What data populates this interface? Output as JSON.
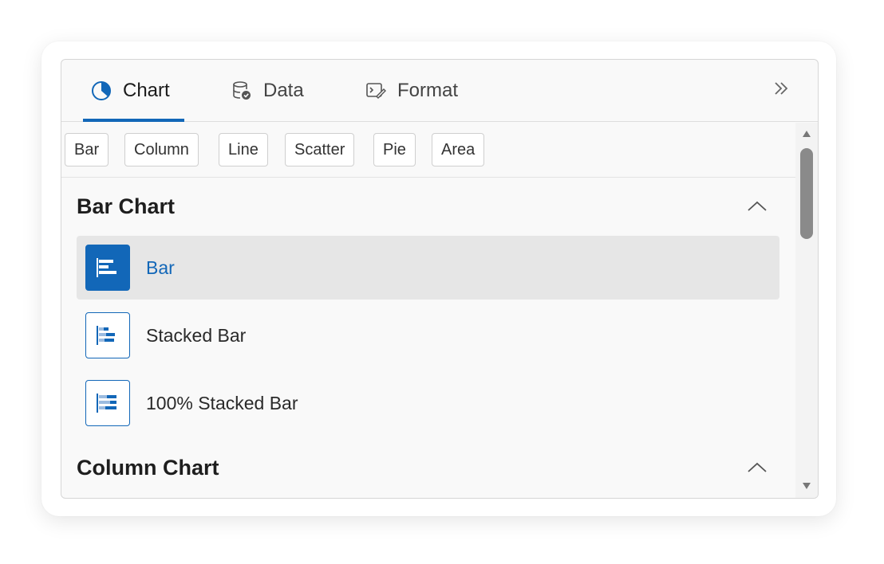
{
  "tabs": [
    {
      "label": "Chart",
      "icon": "pie-chart-icon",
      "active": true
    },
    {
      "label": "Data",
      "icon": "database-check-icon",
      "active": false
    },
    {
      "label": "Format",
      "icon": "format-paint-icon",
      "active": false
    }
  ],
  "collapse_icon": "double-chevron-right-icon",
  "chips": [
    "Bar",
    "Column",
    "Line",
    "Scatter",
    "Pie",
    "Area"
  ],
  "sections": [
    {
      "title": "Bar Chart",
      "expanded": true,
      "items": [
        {
          "label": "Bar",
          "selected": true
        },
        {
          "label": "Stacked Bar",
          "selected": false
        },
        {
          "label": "100% Stacked Bar",
          "selected": false
        }
      ]
    },
    {
      "title": "Column Chart",
      "expanded": true,
      "items": []
    }
  ],
  "colors": {
    "accent": "#1267b8",
    "selected_row": "#e6e6e6",
    "panel_bg": "#f9f9f9"
  }
}
